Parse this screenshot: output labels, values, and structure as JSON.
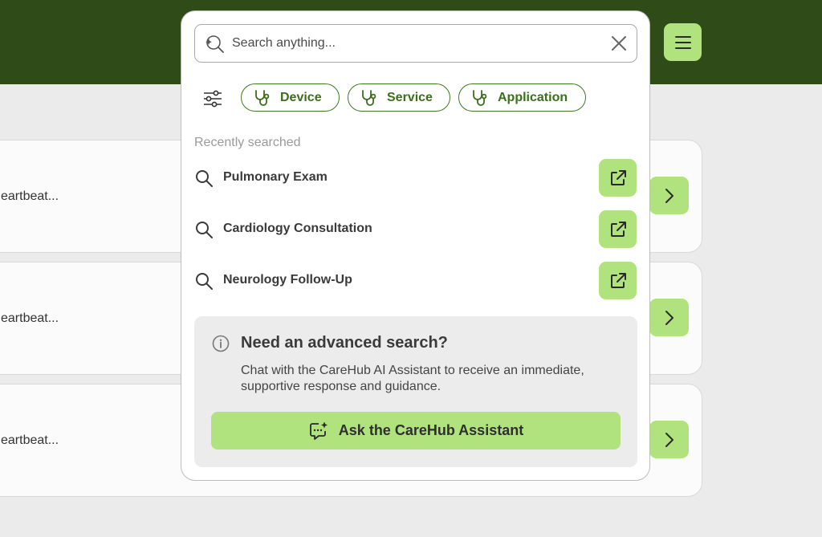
{
  "header": {
    "menu_icon": "hamburger-menu-icon",
    "bar_color": "#2e4b18"
  },
  "background_cards": [
    {
      "text": "eartbeat..."
    },
    {
      "text": "eartbeat..."
    },
    {
      "text": "eartbeat..."
    }
  ],
  "search": {
    "placeholder": "Search anything...",
    "value": ""
  },
  "filters": {
    "chips": [
      {
        "label": "Device",
        "icon": "stethoscope-icon"
      },
      {
        "label": "Service",
        "icon": "stethoscope-icon"
      },
      {
        "label": "Application",
        "icon": "stethoscope-icon"
      }
    ]
  },
  "recent": {
    "title": "Recently searched",
    "items": [
      {
        "label": "Pulmonary Exam"
      },
      {
        "label": "Cardiology Consultation"
      },
      {
        "label": "Neurology Follow-Up"
      }
    ]
  },
  "advanced": {
    "title": "Need an advanced search?",
    "description": "Chat with the CareHub AI Assistant to receive an immediate, supportive response and guidance.",
    "button_label": "Ask the CareHub Assistant"
  },
  "colors": {
    "accent": "#b0e37e",
    "brand_green": "#3b6f1c",
    "dark_green": "#2e4b18"
  }
}
